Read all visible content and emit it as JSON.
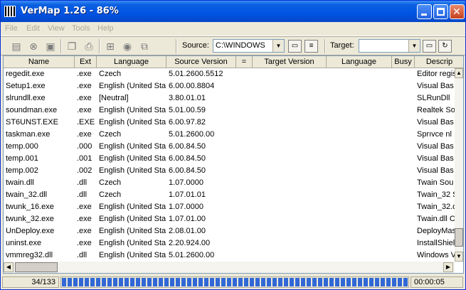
{
  "title": "VerMap 1.26 - 86%",
  "menu": [
    "File",
    "Edit",
    "View",
    "Tools",
    "Help"
  ],
  "toolbar": {
    "icons": [
      "document-icon",
      "stop-icon",
      "save-icon",
      "copy-icon",
      "printer-icon",
      "compare-icon",
      "search-icon",
      "map-icon"
    ],
    "source_label": "Source:",
    "source_value": "C:\\WINDOWS",
    "target_label": "Target:",
    "target_value": ""
  },
  "columns": [
    "Name",
    "Ext",
    "Language",
    "Source Version",
    "=",
    "Target Version",
    "Language",
    "Busy",
    "Descrip"
  ],
  "rows": [
    [
      "regedit.exe",
      ".exe",
      "Czech",
      "5.01.2600.5512",
      "",
      "",
      "",
      "",
      "Editor regis"
    ],
    [
      "Setup1.exe",
      ".exe",
      "English (United Sta",
      "6.00.00.8804",
      "",
      "",
      "",
      "",
      "Visual Bas"
    ],
    [
      "slrundll.exe",
      ".exe",
      "[Neutral]",
      "3.80.01.01",
      "",
      "",
      "",
      "",
      "SLRunDll"
    ],
    [
      "soundman.exe",
      ".exe",
      "English (United Sta",
      "5.01.00.59",
      "",
      "",
      "",
      "",
      "Realtek Sou"
    ],
    [
      "ST6UNST.EXE",
      ".EXE",
      "English (United Sta",
      "6.00.97.82",
      "",
      "",
      "",
      "",
      "Visual Bas"
    ],
    [
      "taskman.exe",
      ".exe",
      "Czech",
      "5.01.2600.00",
      "",
      "",
      "",
      "",
      "Sprıvce nl"
    ],
    [
      "temp.000",
      ".000",
      "English (United Sta",
      "6.00.84.50",
      "",
      "",
      "",
      "",
      "Visual Bas"
    ],
    [
      "temp.001",
      ".001",
      "English (United Sta",
      "6.00.84.50",
      "",
      "",
      "",
      "",
      "Visual Bas"
    ],
    [
      "temp.002",
      ".002",
      "English (United Sta",
      "6.00.84.50",
      "",
      "",
      "",
      "",
      "Visual Bas"
    ],
    [
      "twain.dll",
      ".dll",
      "Czech",
      "1.07.0000",
      "",
      "",
      "",
      "",
      "Twain Sou"
    ],
    [
      "twain_32.dll",
      ".dll",
      "Czech",
      "1.07.01.01",
      "",
      "",
      "",
      "",
      "Twain_32 S"
    ],
    [
      "twunk_16.exe",
      ".exe",
      "English (United Sta",
      "1.07.0000",
      "",
      "",
      "",
      "",
      "Twain_32.d"
    ],
    [
      "twunk_32.exe",
      ".exe",
      "English (United Sta",
      "1.07.01.00",
      "",
      "",
      "",
      "",
      "Twain.dll C"
    ],
    [
      "UnDeploy.exe",
      ".exe",
      "English (United Sta",
      "2.08.01.00",
      "",
      "",
      "",
      "",
      "DeployMas"
    ],
    [
      "uninst.exe",
      ".exe",
      "English (United Sta",
      "2.20.924.00",
      "",
      "",
      "",
      "",
      "InstallShiel"
    ],
    [
      "vmmreg32.dll",
      ".dll",
      "English (United Sta",
      "5.01.2600.00",
      "",
      "",
      "",
      "",
      "Windows V"
    ]
  ],
  "status": {
    "count": "34/133",
    "progress_fraction": 1.0,
    "elapsed": "00:00:05"
  },
  "colors": {
    "title_bar": "#0054e3",
    "progress": "#3168d5",
    "face": "#ece9d8"
  }
}
